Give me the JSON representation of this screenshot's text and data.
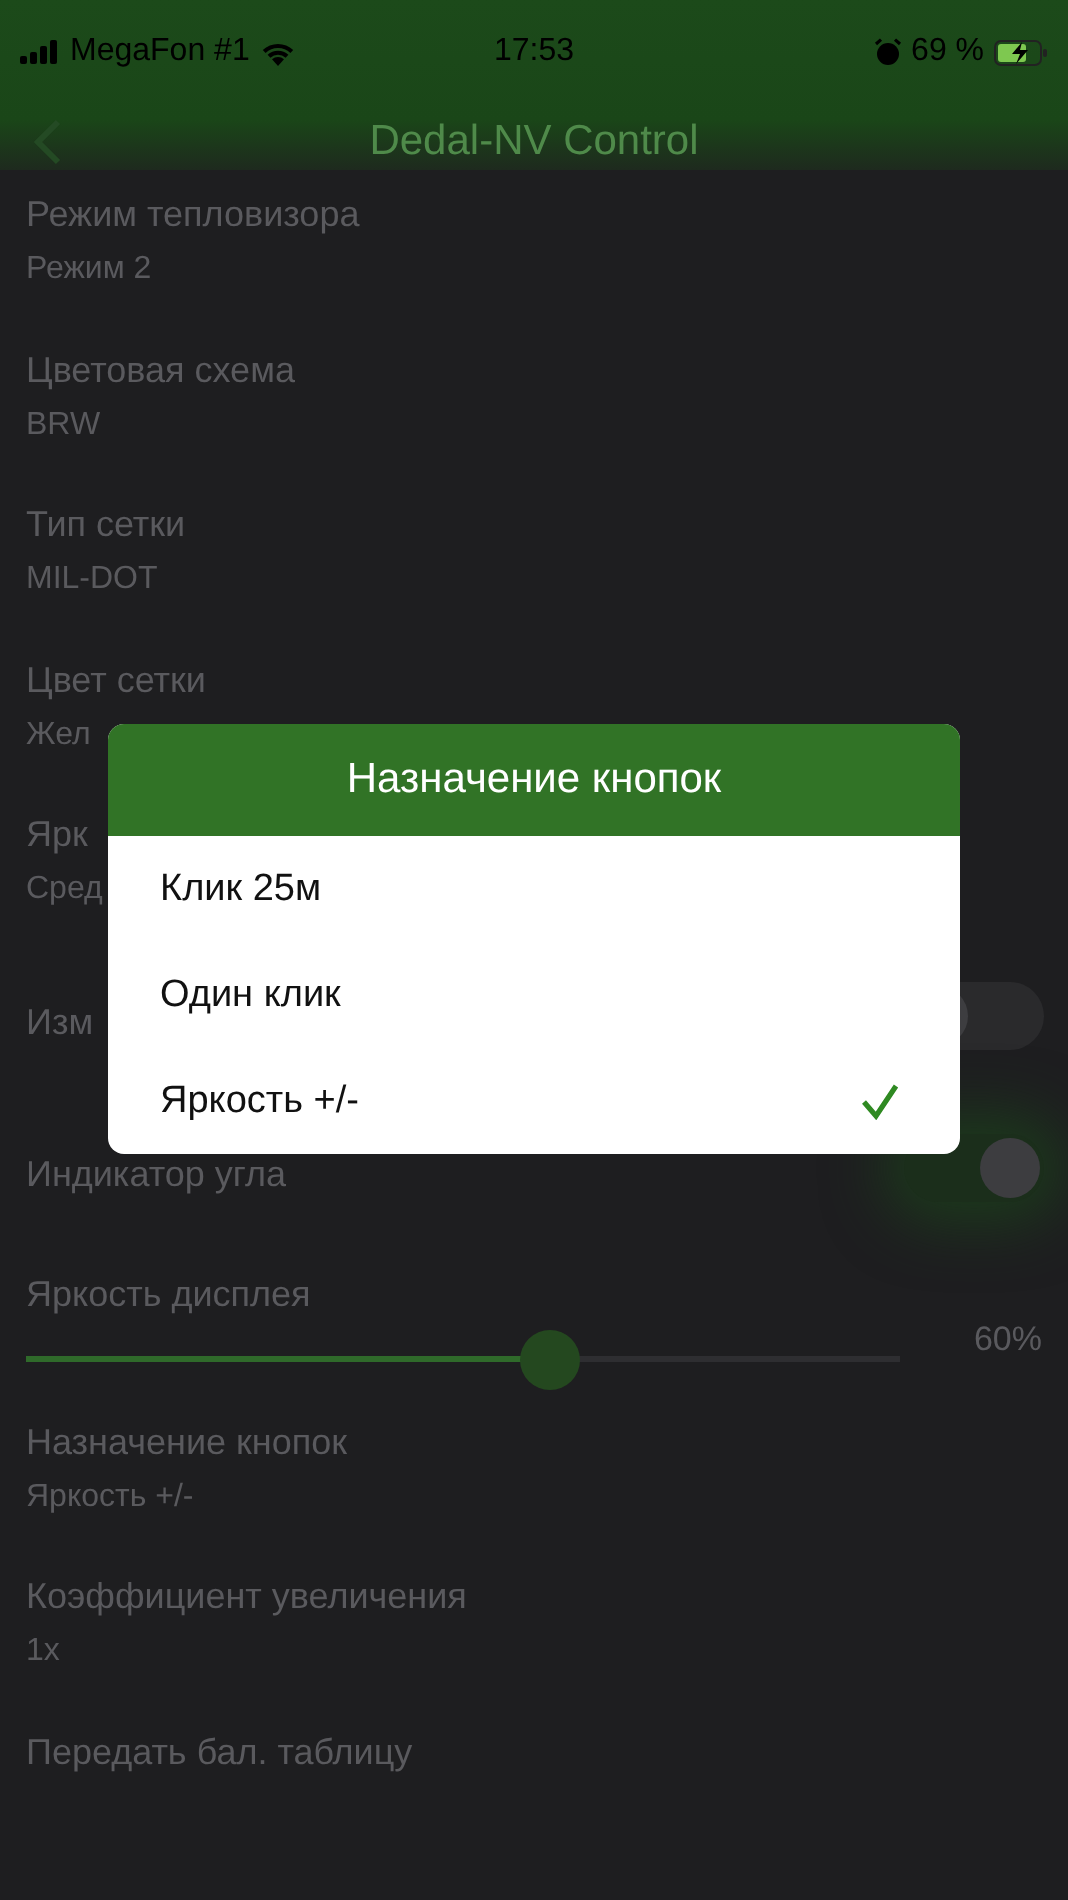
{
  "status_bar": {
    "carrier": "MegaFon #1",
    "time": "17:53",
    "battery": "69 %"
  },
  "nav_bar": {
    "title": "Dedal-NV Control"
  },
  "settings": [
    {
      "kind": "value",
      "label": "Режим тепловизора",
      "value": "Режим 2"
    },
    {
      "kind": "value",
      "label": "Цветовая схема",
      "value": "BRW"
    },
    {
      "kind": "value",
      "label": "Тип сетки",
      "value": "MIL-DOT"
    },
    {
      "kind": "value",
      "label": "Цвет сетки",
      "value": "Жел"
    },
    {
      "kind": "value",
      "label": "Ярк",
      "value": "Сред"
    },
    {
      "kind": "switch",
      "label": "Изм",
      "on": false
    },
    {
      "kind": "switch",
      "label": "Индикатор угла",
      "on": true
    },
    {
      "kind": "slider",
      "label": "Яркость дисплея",
      "reading": "60%",
      "level": 0.6
    },
    {
      "kind": "value",
      "label": "Назначение кнопок",
      "value": "Яркость +/-"
    },
    {
      "kind": "value",
      "label": "Коэффициент увеличения",
      "value": "1x"
    },
    {
      "kind": "action",
      "label": "Передать бал. таблицу"
    }
  ],
  "dialog": {
    "title": "Назначение кнопок",
    "options": [
      {
        "label": "Клик 25м",
        "selected": false
      },
      {
        "label": "Один клик",
        "selected": false
      },
      {
        "label": "Яркость +/-",
        "selected": true
      }
    ]
  }
}
